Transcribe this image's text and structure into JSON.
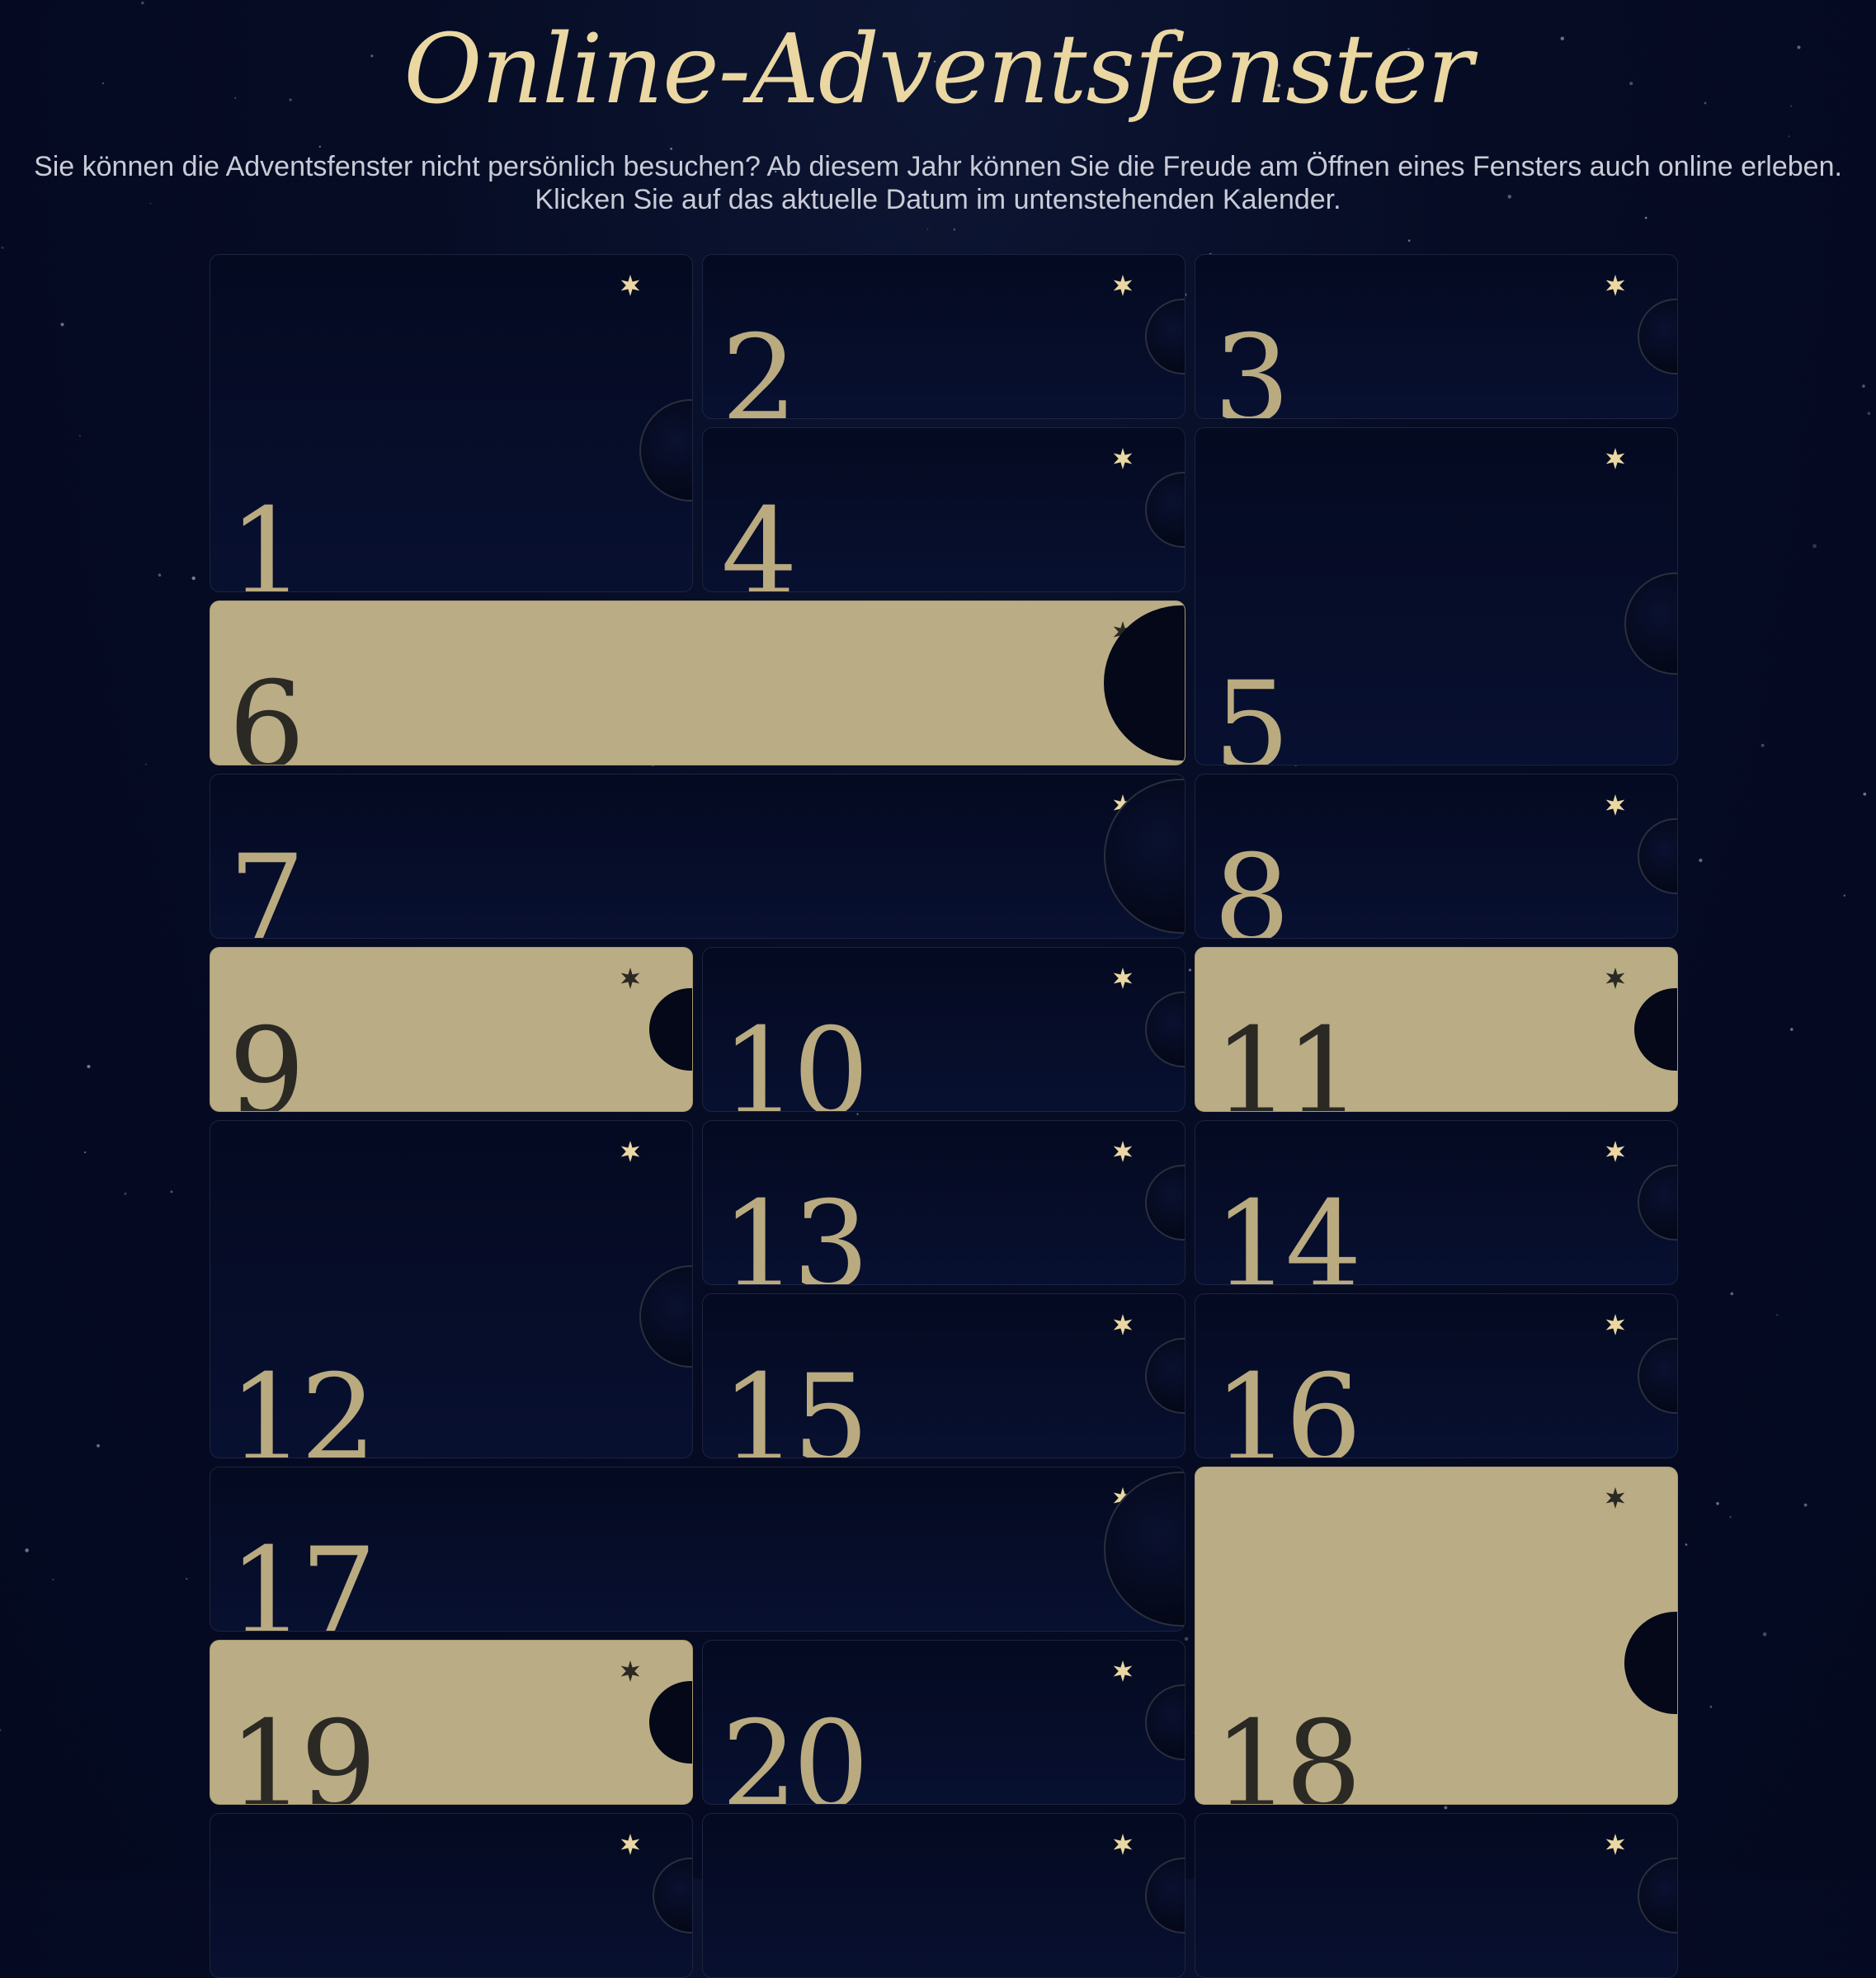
{
  "page": {
    "title": "Online-Adventsfenster",
    "intro": "Sie können die Adventsfenster nicht persönlich besuchen? Ab diesem Jahr können Sie die Freude am Öffnen eines Fensters auch online erleben. Klicken Sie auf das aktuelle Datum im untenstehenden Kalender."
  },
  "colors": {
    "background": "#050b22",
    "gold": "#ead7a2",
    "door_open": "#baac84",
    "door_closed": "#060c26",
    "number_closed": "#b9aa80",
    "number_open": "#2a2924"
  },
  "calendar": {
    "doors": [
      {
        "day": "1",
        "open": false
      },
      {
        "day": "2",
        "open": false
      },
      {
        "day": "3",
        "open": false
      },
      {
        "day": "4",
        "open": false
      },
      {
        "day": "5",
        "open": false
      },
      {
        "day": "6",
        "open": true
      },
      {
        "day": "7",
        "open": false
      },
      {
        "day": "8",
        "open": false
      },
      {
        "day": "9",
        "open": true
      },
      {
        "day": "10",
        "open": false
      },
      {
        "day": "11",
        "open": true
      },
      {
        "day": "12",
        "open": false
      },
      {
        "day": "13",
        "open": false
      },
      {
        "day": "14",
        "open": false
      },
      {
        "day": "15",
        "open": false
      },
      {
        "day": "16",
        "open": false
      },
      {
        "day": "17",
        "open": false
      },
      {
        "day": "18",
        "open": true
      },
      {
        "day": "19",
        "open": true
      },
      {
        "day": "20",
        "open": false
      },
      {
        "day": "",
        "open": false
      },
      {
        "day": "",
        "open": false
      },
      {
        "day": "",
        "open": false
      }
    ],
    "star_icon": "six-point-star-icon",
    "moon_icon": "crescent-moon-icon"
  }
}
